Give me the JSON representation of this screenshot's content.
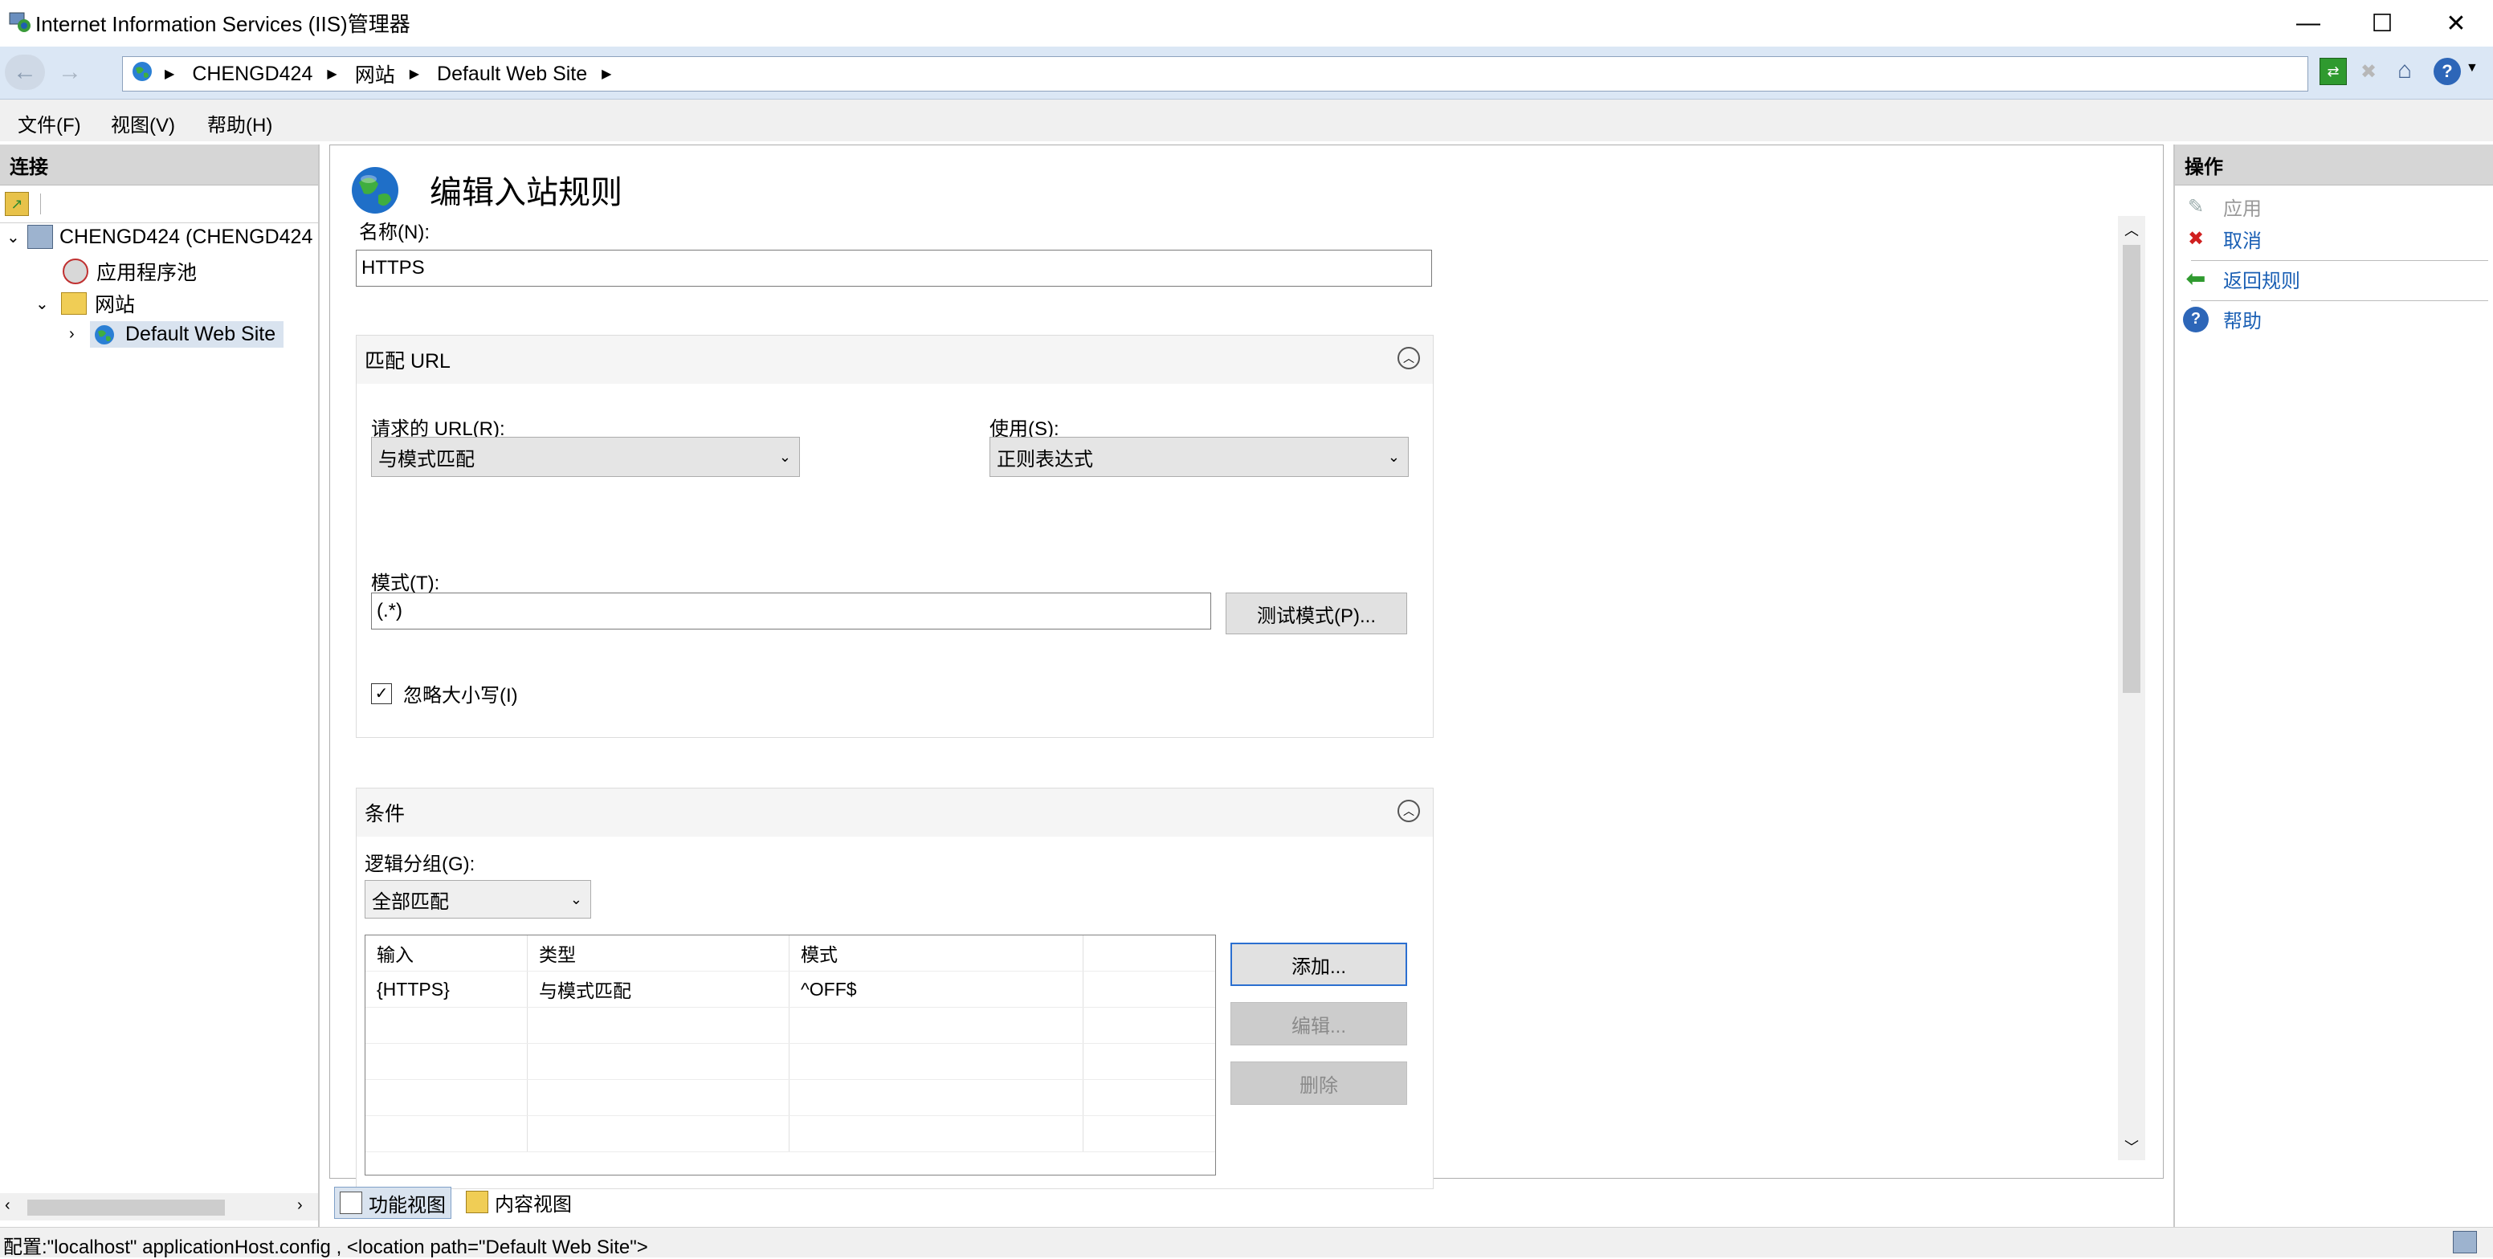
{
  "window": {
    "title": "Internet Information Services (IIS)管理器",
    "minimize": "—",
    "maximize": "☐",
    "close": "✕"
  },
  "address": {
    "crumbs": [
      "CHENGD424",
      "网站",
      "Default Web Site"
    ]
  },
  "menu": [
    "文件(F)",
    "视图(V)",
    "帮助(H)"
  ],
  "connections": {
    "header": "连接",
    "tree": {
      "server": "CHENGD424 (CHENGD424",
      "app_pools": "应用程序池",
      "sites": "网站",
      "default_site": "Default Web Site"
    }
  },
  "main": {
    "page_title": "编辑入站规则",
    "name_label": "名称(N):",
    "name_value": "HTTPS",
    "match_url": {
      "header": "匹配 URL",
      "requested_url_label": "请求的 URL(R):",
      "requested_url_value": "与模式匹配",
      "using_label": "使用(S):",
      "using_value": "正则表达式",
      "pattern_label": "模式(T):",
      "pattern_value": "(.*)",
      "test_button": "测试模式(P)...",
      "ignore_case_label": "忽略大小写(I)",
      "ignore_case_checked": true
    },
    "conditions": {
      "header": "条件",
      "logical_grouping_label": "逻辑分组(G):",
      "logical_grouping_value": "全部匹配",
      "columns": [
        "输入",
        "类型",
        "模式"
      ],
      "rows": [
        [
          "{HTTPS}",
          "与模式匹配",
          "^OFF$"
        ]
      ],
      "add_button": "添加...",
      "edit_button": "编辑...",
      "delete_button": "删除"
    }
  },
  "bottom_tabs": [
    "功能视图",
    "内容视图"
  ],
  "actions": {
    "header": "操作",
    "apply": "应用",
    "cancel": "取消",
    "back": "返回规则",
    "help": "帮助"
  },
  "status": {
    "text": "配置:\"localhost\" applicationHost.config , <location path=\"Default Web Site\">"
  }
}
